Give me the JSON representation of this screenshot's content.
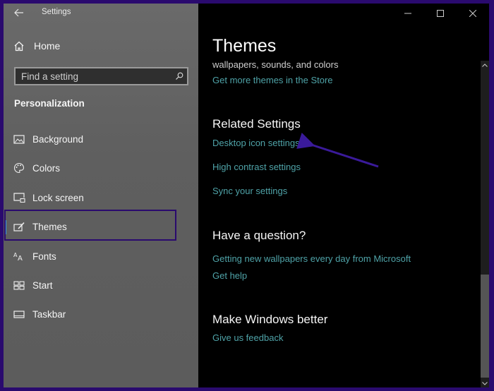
{
  "window": {
    "app_title": "Settings",
    "controls": {
      "minimize": "minimize",
      "maximize": "maximize",
      "close": "close"
    }
  },
  "sidebar": {
    "home_label": "Home",
    "search": {
      "placeholder": "Find a setting",
      "value": ""
    },
    "section_title": "Personalization",
    "items": [
      {
        "label": "Background",
        "icon": "picture-icon"
      },
      {
        "label": "Colors",
        "icon": "palette-icon"
      },
      {
        "label": "Lock screen",
        "icon": "lock-screen-icon"
      },
      {
        "label": "Themes",
        "icon": "themes-icon",
        "active": true
      },
      {
        "label": "Fonts",
        "icon": "fonts-icon"
      },
      {
        "label": "Start",
        "icon": "start-icon"
      },
      {
        "label": "Taskbar",
        "icon": "taskbar-icon"
      }
    ]
  },
  "main": {
    "title": "Themes",
    "subtitle": "wallpapers, sounds, and colors",
    "store_link": "Get more themes in the Store",
    "related": {
      "heading": "Related Settings",
      "links": [
        "Desktop icon settings",
        "High contrast settings",
        "Sync your settings"
      ]
    },
    "question": {
      "heading": "Have a question?",
      "links": [
        "Getting new wallpapers every day from Microsoft",
        "Get help"
      ]
    },
    "better": {
      "heading": "Make Windows better",
      "links": [
        "Give us feedback"
      ]
    }
  },
  "colors": {
    "accent": "#3aa0e0",
    "link": "#4fa3a8",
    "annotation": "#2a0a6e",
    "arrow": "#3a1a9a"
  }
}
